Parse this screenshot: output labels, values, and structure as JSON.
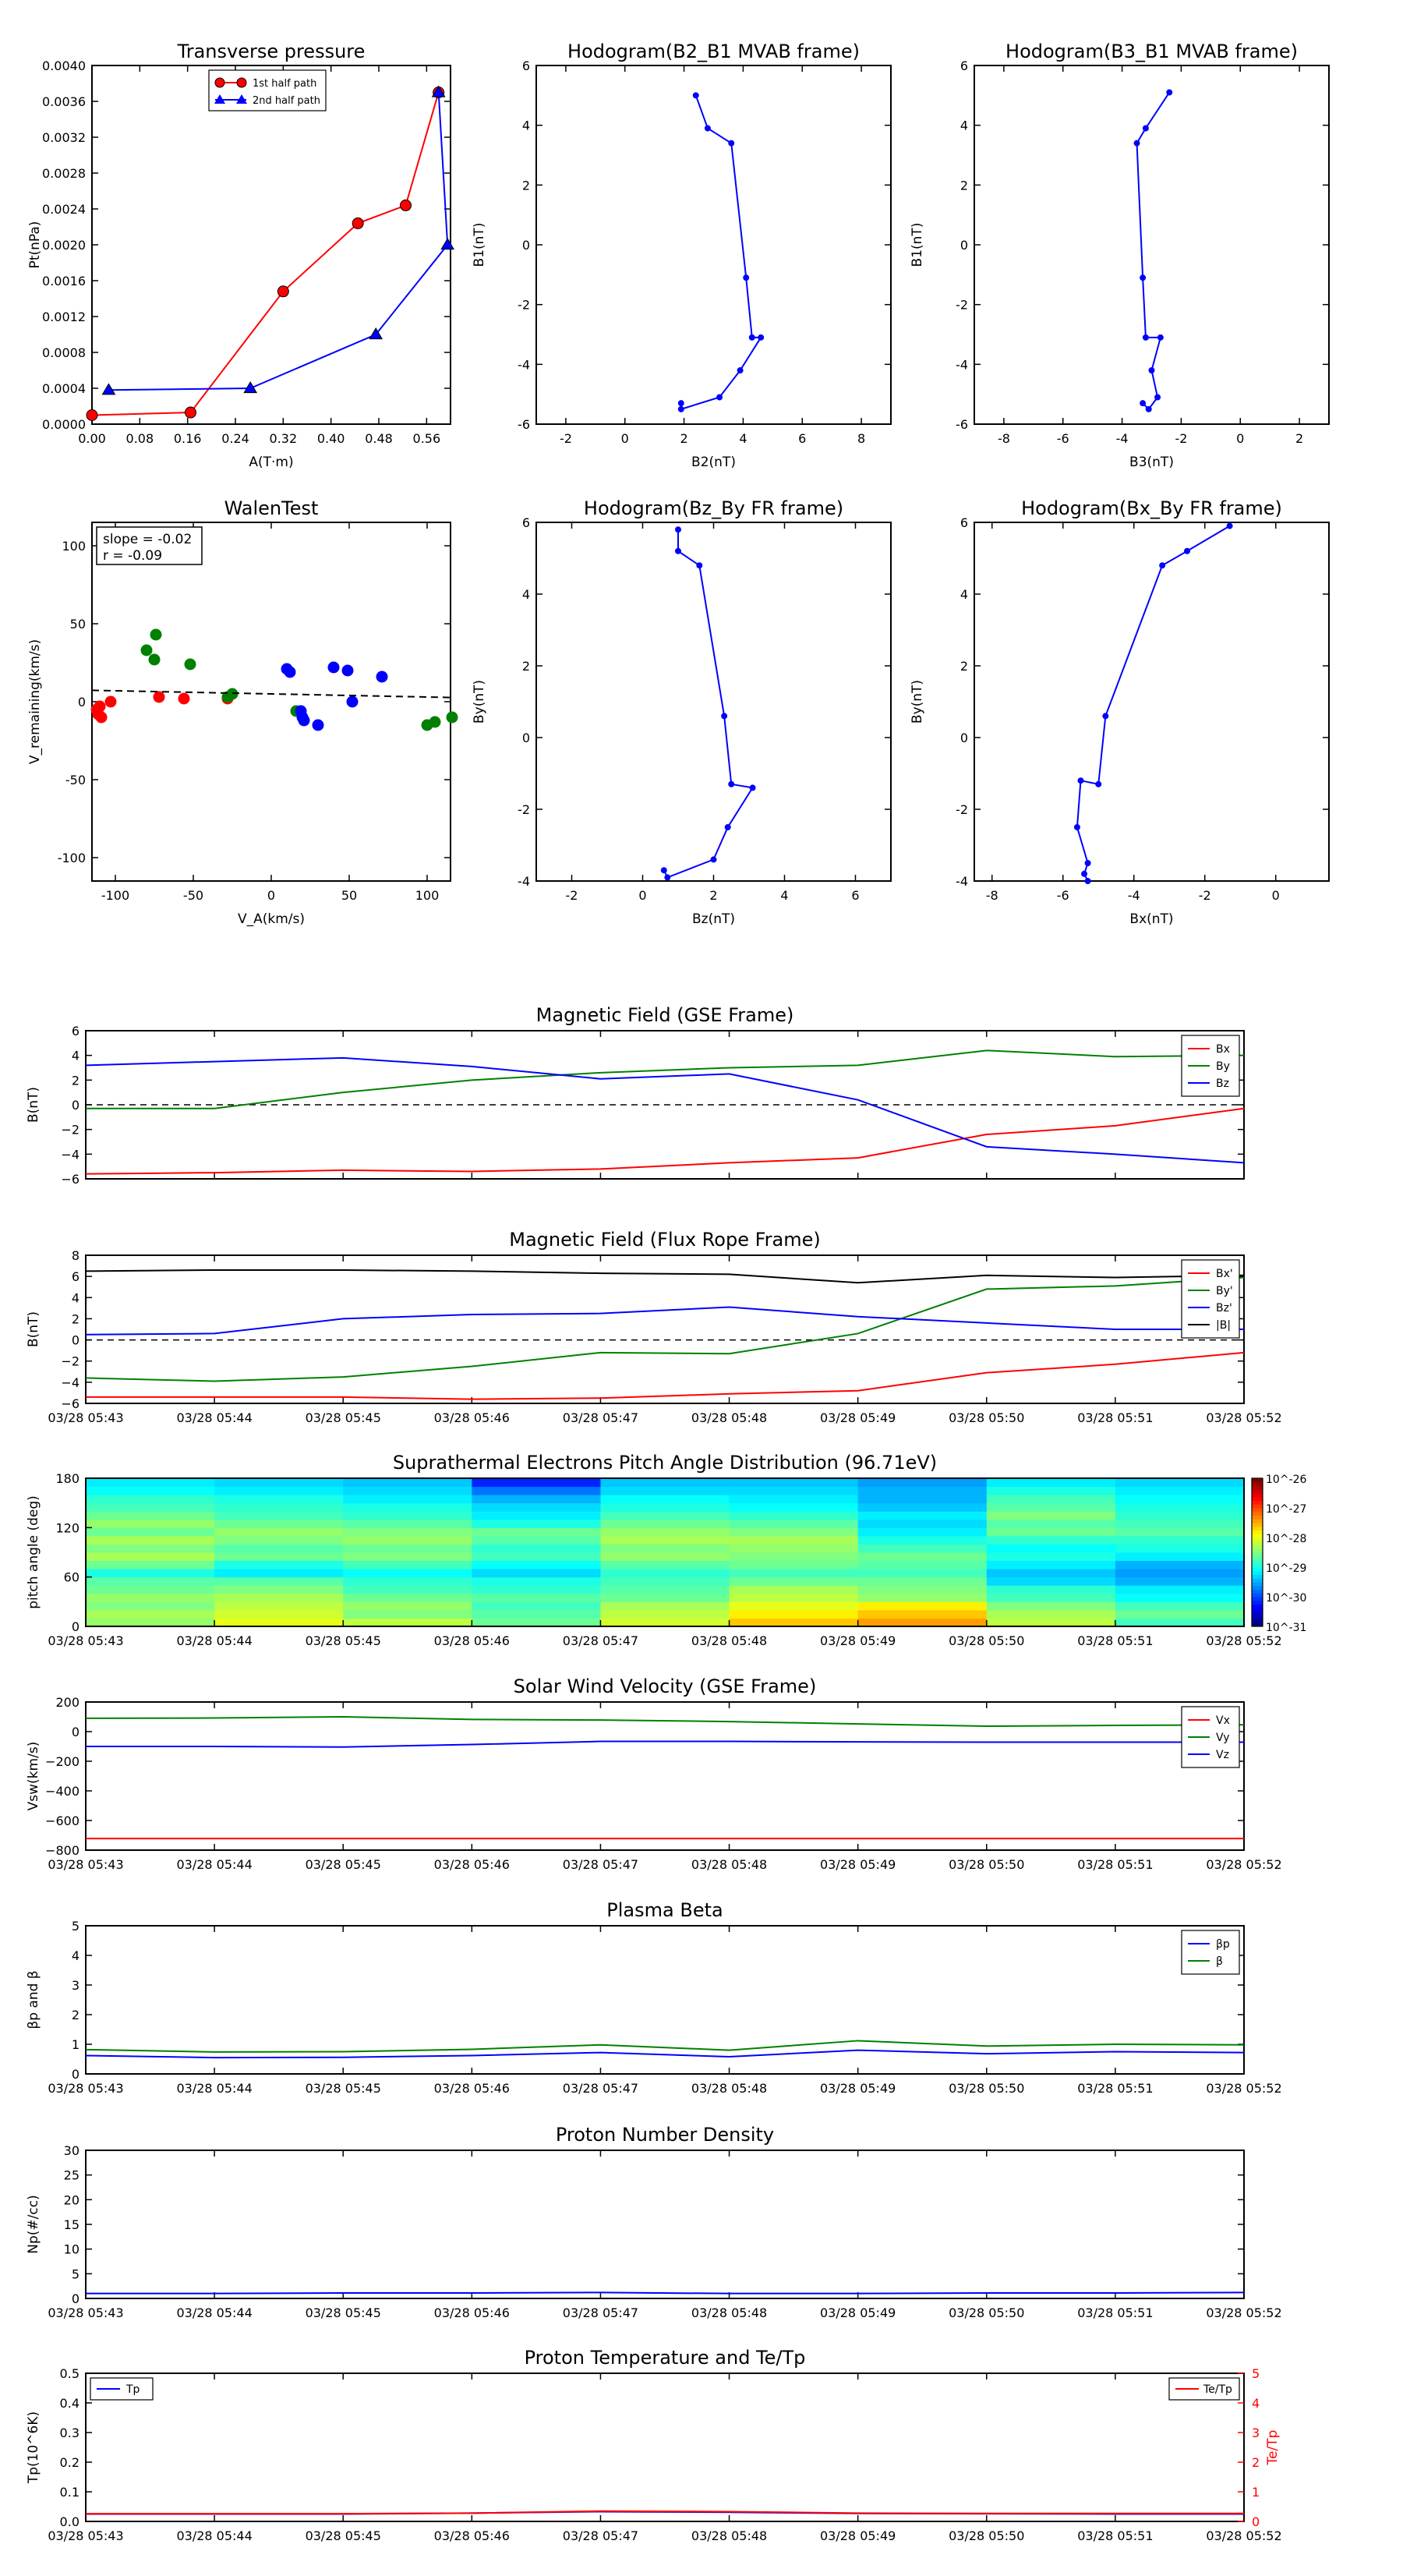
{
  "times": [
    "03/28 05:43",
    "03/28 05:44",
    "03/28 05:45",
    "03/28 05:46",
    "03/28 05:47",
    "03/28 05:48",
    "03/28 05:49",
    "03/28 05:50",
    "03/28 05:51",
    "03/28 05:52"
  ],
  "colors": {
    "red": "#ff0000",
    "green": "#008000",
    "blue": "#0000ff",
    "black": "#000000"
  },
  "chart_data": [
    {
      "id": "pt",
      "type": "line",
      "title": "Transverse pressure",
      "xlabel": "A(T·m)",
      "ylabel": "Pt(nPa)",
      "xlim": [
        0,
        0.6
      ],
      "ylim": [
        0,
        0.004
      ],
      "xticks": [
        "0.00",
        "0.08",
        "0.16",
        "0.24",
        "0.32",
        "0.40",
        "0.48",
        "0.56"
      ],
      "yticks": [
        "0.0000",
        "0.0004",
        "0.0008",
        "0.0012",
        "0.0016",
        "0.0020",
        "0.0024",
        "0.0028",
        "0.0032",
        "0.0036",
        "0.0040"
      ],
      "legend": "top-center",
      "series": [
        {
          "name": "1st half path",
          "color": "red",
          "marker": "circle",
          "x": [
            0.0,
            0.165,
            0.32,
            0.445,
            0.525,
            0.58
          ],
          "y": [
            0.0001,
            0.00013,
            0.00148,
            0.00224,
            0.00244,
            0.0037
          ]
        },
        {
          "name": "2nd half path",
          "color": "blue",
          "marker": "triangle",
          "x": [
            0.58,
            0.595,
            0.475,
            0.265,
            0.028
          ],
          "y": [
            0.0037,
            0.002,
            0.001,
            0.0004,
            0.00038
          ]
        }
      ]
    },
    {
      "id": "h1",
      "type": "line",
      "title": "Hodogram(B2_B1 MVAB frame)",
      "xlabel": "B2(nT)",
      "ylabel": "B1(nT)",
      "xlim": [
        -3,
        9
      ],
      "ylim": [
        -6,
        6
      ],
      "xticks": [
        "-2",
        "0",
        "2",
        "4",
        "6",
        "8"
      ],
      "yticks": [
        "-6",
        "-4",
        "-2",
        "0",
        "2",
        "4",
        "6"
      ],
      "series": [
        {
          "color": "blue",
          "x": [
            2.4,
            2.8,
            3.6,
            4.1,
            4.3,
            4.6,
            3.9,
            3.2,
            1.9,
            1.9
          ],
          "y": [
            5.0,
            3.9,
            3.4,
            -1.1,
            -3.1,
            -3.1,
            -4.2,
            -5.1,
            -5.5,
            -5.3
          ]
        }
      ]
    },
    {
      "id": "h2",
      "type": "line",
      "title": "Hodogram(B3_B1 MVAB frame)",
      "xlabel": "B3(nT)",
      "ylabel": "B1(nT)",
      "xlim": [
        -9,
        3
      ],
      "ylim": [
        -6,
        6
      ],
      "xticks": [
        "-8",
        "-6",
        "-4",
        "-2",
        "0",
        "2"
      ],
      "yticks": [
        "-6",
        "-4",
        "-2",
        "0",
        "2",
        "4",
        "6"
      ],
      "series": [
        {
          "color": "blue",
          "x": [
            -2.4,
            -3.2,
            -3.5,
            -3.3,
            -3.2,
            -2.7,
            -3.0,
            -2.8,
            -3.1,
            -3.3
          ],
          "y": [
            5.1,
            3.9,
            3.4,
            -1.1,
            -3.1,
            -3.1,
            -4.2,
            -5.1,
            -5.5,
            -5.3
          ]
        }
      ]
    },
    {
      "id": "walen",
      "type": "scatter",
      "title": "WalenTest",
      "xlabel": "V_A(km/s)",
      "ylabel": "V_remaining(km/s)",
      "xlim": [
        -115,
        115
      ],
      "ylim": [
        -115,
        115
      ],
      "xticks": [
        "-100",
        "-50",
        "0",
        "50",
        "100"
      ],
      "yticks": [
        "-100",
        "-50",
        "0",
        "50",
        "100"
      ],
      "annotation_lines": [
        "slope = -0.02",
        "r = -0.09"
      ],
      "fit": {
        "slope": -0.02,
        "intercept": 5
      },
      "series": [
        {
          "color": "red",
          "x": [
            -112,
            -111,
            -110,
            -109,
            -103,
            -72,
            -56,
            -28
          ],
          "y": [
            -5,
            -8,
            -3,
            -10,
            0,
            3,
            2,
            2
          ]
        },
        {
          "color": "green",
          "x": [
            -80,
            -75,
            -74,
            -52,
            -28,
            -25,
            16,
            100,
            105,
            116
          ],
          "y": [
            33,
            27,
            43,
            24,
            3,
            5,
            -6,
            -15,
            -13,
            -10
          ]
        },
        {
          "color": "blue",
          "x": [
            10,
            12,
            19,
            20,
            21,
            30,
            40,
            49,
            52,
            71
          ],
          "y": [
            21,
            19,
            -6,
            -10,
            -12,
            -15,
            22,
            20,
            0,
            16
          ]
        }
      ]
    },
    {
      "id": "h3",
      "type": "line",
      "title": "Hodogram(Bz_By FR frame)",
      "xlabel": "Bz(nT)",
      "ylabel": "By(nT)",
      "xlim": [
        -3,
        7
      ],
      "ylim": [
        -4,
        6
      ],
      "xticks": [
        "-2",
        "0",
        "2",
        "4",
        "6"
      ],
      "yticks": [
        "-4",
        "-2",
        "0",
        "2",
        "4",
        "6"
      ],
      "series": [
        {
          "color": "blue",
          "x": [
            1.0,
            1.0,
            1.6,
            2.3,
            2.5,
            3.1,
            2.4,
            2.0,
            0.7,
            0.6
          ],
          "y": [
            5.8,
            5.2,
            4.8,
            0.6,
            -1.3,
            -1.4,
            -2.5,
            -3.4,
            -3.9,
            -3.7
          ]
        }
      ]
    },
    {
      "id": "h4",
      "type": "line",
      "title": "Hodogram(Bx_By FR frame)",
      "xlabel": "Bx(nT)",
      "ylabel": "By(nT)",
      "xlim": [
        -8.5,
        1.5
      ],
      "ylim": [
        -4,
        6
      ],
      "xticks": [
        "-8",
        "-6",
        "-4",
        "-2",
        "0"
      ],
      "yticks": [
        "-4",
        "-2",
        "0",
        "2",
        "4",
        "6"
      ],
      "series": [
        {
          "color": "blue",
          "x": [
            -1.3,
            -2.5,
            -3.2,
            -4.8,
            -5.0,
            -5.5,
            -5.6,
            -5.3,
            -5.4,
            -5.3
          ],
          "y": [
            5.9,
            5.2,
            4.8,
            0.6,
            -1.3,
            -1.2,
            -2.5,
            -3.5,
            -3.8,
            -4.0
          ]
        }
      ]
    },
    {
      "id": "bgse",
      "type": "line",
      "title": "Magnetic Field (GSE Frame)",
      "ylabel": "B(nT)",
      "ylim": [
        -6,
        6
      ],
      "yticks": [
        "−6",
        "−4",
        "−2",
        "0",
        "2",
        "4",
        "6"
      ],
      "xtick_labels": false,
      "zero_line": true,
      "legend": "top-right",
      "series": [
        {
          "name": "Bx",
          "color": "red",
          "values": [
            -5.6,
            -5.5,
            -5.3,
            -5.4,
            -5.2,
            -4.7,
            -4.3,
            -2.4,
            -1.7,
            -0.3
          ]
        },
        {
          "name": "By",
          "color": "green",
          "values": [
            -0.3,
            -0.3,
            1.0,
            2.0,
            2.6,
            3.0,
            3.2,
            4.4,
            3.9,
            4.0
          ]
        },
        {
          "name": "Bz",
          "color": "blue",
          "values": [
            3.2,
            3.5,
            3.8,
            3.1,
            2.1,
            2.5,
            0.4,
            -3.4,
            -4.0,
            -4.7
          ]
        }
      ]
    },
    {
      "id": "bfr",
      "type": "line",
      "title": "Magnetic Field (Flux Rope Frame)",
      "ylabel": "B(nT)",
      "ylim": [
        -6,
        8
      ],
      "yticks": [
        "−6",
        "−4",
        "−2",
        "0",
        "2",
        "4",
        "6",
        "8"
      ],
      "xtick_labels": true,
      "zero_line": true,
      "legend": "top-right",
      "series": [
        {
          "name": "Bx'",
          "color": "red",
          "values": [
            -5.4,
            -5.4,
            -5.4,
            -5.6,
            -5.5,
            -5.1,
            -4.8,
            -3.1,
            -2.3,
            -1.2
          ]
        },
        {
          "name": "By'",
          "color": "green",
          "values": [
            -3.6,
            -3.9,
            -3.5,
            -2.5,
            -1.2,
            -1.3,
            0.6,
            4.8,
            5.1,
            5.9
          ]
        },
        {
          "name": "Bz'",
          "color": "blue",
          "values": [
            0.5,
            0.6,
            2.0,
            2.4,
            2.5,
            3.1,
            2.2,
            1.6,
            1.0,
            1.0
          ]
        },
        {
          "name": "|B|",
          "color": "black",
          "values": [
            6.5,
            6.6,
            6.6,
            6.5,
            6.3,
            6.2,
            5.4,
            6.1,
            5.9,
            6.1
          ]
        }
      ]
    },
    {
      "id": "pad",
      "type": "heatmap",
      "title": "Suprathermal Electrons Pitch Angle Distribution (96.71eV)",
      "ylabel": "pitch angle (deg)",
      "ylim": [
        0,
        180
      ],
      "yticks": [
        "0",
        "60",
        "120",
        "180"
      ],
      "xtick_labels": true,
      "colorbar": {
        "labels": [
          "10^-31",
          "10^-30",
          "10^-29",
          "10^-28",
          "10^-27",
          "10^-26"
        ],
        "range_exp": [
          -31,
          -26
        ]
      },
      "bins": [
        [
          -28.4,
          -28.0,
          -28.2,
          -28.6,
          -28.1,
          -27.6,
          -27.4,
          -28.2,
          -28.8
        ],
        [
          -28.3,
          -28.1,
          -28.5,
          -28.7,
          -28.2,
          -27.8,
          -27.6,
          -28.3,
          -28.6
        ],
        [
          -28.5,
          -28.2,
          -28.4,
          -28.8,
          -28.3,
          -28.0,
          -27.8,
          -28.5,
          -28.8
        ],
        [
          -28.4,
          -28.3,
          -28.6,
          -28.7,
          -28.6,
          -28.2,
          -28.4,
          -28.8,
          -29.1
        ],
        [
          -28.6,
          -28.5,
          -28.8,
          -28.9,
          -28.7,
          -28.3,
          -28.5,
          -28.9,
          -29.2
        ],
        [
          -28.7,
          -28.7,
          -28.9,
          -29.0,
          -28.8,
          -28.6,
          -28.6,
          -29.3,
          -29.5
        ],
        [
          -29.0,
          -29.2,
          -29.1,
          -29.3,
          -28.9,
          -28.8,
          -28.8,
          -29.4,
          -29.6
        ],
        [
          -28.6,
          -29.0,
          -28.8,
          -29.1,
          -28.7,
          -28.6,
          -28.7,
          -29.2,
          -29.5
        ],
        [
          -28.3,
          -28.6,
          -28.5,
          -28.8,
          -28.4,
          -28.5,
          -28.6,
          -29.0,
          -29.2
        ],
        [
          -28.5,
          -28.7,
          -28.6,
          -28.9,
          -28.5,
          -28.4,
          -28.8,
          -29.1,
          -29.0
        ],
        [
          -28.3,
          -28.5,
          -28.4,
          -28.7,
          -28.3,
          -28.3,
          -29.0,
          -28.9,
          -28.9
        ],
        [
          -28.6,
          -28.4,
          -28.5,
          -28.6,
          -28.4,
          -28.5,
          -29.2,
          -28.6,
          -28.7
        ],
        [
          -28.4,
          -28.6,
          -28.7,
          -29.0,
          -28.6,
          -28.7,
          -29.3,
          -28.7,
          -28.8
        ],
        [
          -28.6,
          -28.8,
          -28.9,
          -29.2,
          -28.8,
          -28.9,
          -29.2,
          -28.5,
          -28.9
        ],
        [
          -28.8,
          -28.9,
          -29.0,
          -29.3,
          -29.0,
          -29.1,
          -29.4,
          -28.7,
          -29.0
        ],
        [
          -28.9,
          -29.0,
          -29.2,
          -29.5,
          -29.1,
          -29.2,
          -29.5,
          -28.8,
          -29.1
        ],
        [
          -29.1,
          -29.2,
          -29.3,
          -29.8,
          -29.3,
          -29.3,
          -29.5,
          -29.0,
          -29.2
        ],
        [
          -29.2,
          -29.3,
          -29.4,
          -30.2,
          -29.4,
          -29.4,
          -29.6,
          -29.2,
          -29.3
        ]
      ]
    },
    {
      "id": "vsw",
      "type": "line",
      "title": "Solar Wind Velocity (GSE Frame)",
      "ylabel": "Vsw(km/s)",
      "ylim": [
        -800,
        200
      ],
      "yticks": [
        "−800",
        "−600",
        "−400",
        "−200",
        "0",
        "200"
      ],
      "xtick_labels": true,
      "legend": "top-right",
      "series": [
        {
          "name": "Vx",
          "color": "red",
          "values": [
            -722,
            -722,
            -722,
            -722,
            -722,
            -722,
            -722,
            -722,
            -722,
            -722
          ]
        },
        {
          "name": "Vy",
          "color": "green",
          "values": [
            90,
            92,
            100,
            82,
            78,
            68,
            52,
            37,
            42,
            46
          ]
        },
        {
          "name": "Vz",
          "color": "blue",
          "values": [
            -100,
            -100,
            -104,
            -87,
            -66,
            -66,
            -69,
            -71,
            -71,
            -71
          ]
        }
      ]
    },
    {
      "id": "beta",
      "type": "line",
      "title": "Plasma Beta",
      "ylabel": "βp and β",
      "ylim": [
        0,
        5
      ],
      "yticks": [
        "0",
        "1",
        "2",
        "3",
        "4",
        "5"
      ],
      "xtick_labels": true,
      "legend": "top-right",
      "series": [
        {
          "name": "βp",
          "color": "blue",
          "values": [
            0.62,
            0.55,
            0.56,
            0.62,
            0.72,
            0.58,
            0.8,
            0.68,
            0.75,
            0.72
          ]
        },
        {
          "name": "β",
          "color": "green",
          "values": [
            0.82,
            0.74,
            0.75,
            0.83,
            0.98,
            0.8,
            1.12,
            0.94,
            1.0,
            0.98
          ]
        }
      ]
    },
    {
      "id": "np",
      "type": "line",
      "title": "Proton Number Density",
      "ylabel": "Np(#/cc)",
      "ylim": [
        0,
        30
      ],
      "yticks": [
        "0",
        "5",
        "10",
        "15",
        "20",
        "25",
        "30"
      ],
      "xtick_labels": true,
      "series": [
        {
          "name": "Np",
          "color": "blue",
          "values": [
            1.0,
            1.0,
            1.1,
            1.1,
            1.2,
            1.0,
            1.0,
            1.1,
            1.1,
            1.2
          ]
        }
      ]
    },
    {
      "id": "tp",
      "type": "line",
      "title": "Proton Temperature and Te/Tp",
      "ylabel": "Tp(10^6K)",
      "ylabel_right": "Te/Tp",
      "ylim": [
        0,
        0.5
      ],
      "ylim_right": [
        0,
        5
      ],
      "yticks": [
        "0.0",
        "0.1",
        "0.2",
        "0.3",
        "0.4",
        "0.5"
      ],
      "yticks_right": [
        "0",
        "1",
        "2",
        "3",
        "4",
        "5"
      ],
      "xtick_labels": true,
      "legend_left": "Tp",
      "legend_right": "Te/Tp",
      "series": [
        {
          "name": "Tp",
          "color": "blue",
          "values": [
            0.025,
            0.025,
            0.025,
            0.028,
            0.033,
            0.031,
            0.027,
            0.026,
            0.025,
            0.025
          ]
        },
        {
          "name": "Te/Tp",
          "color": "red",
          "axis": "right",
          "values": [
            0.26,
            0.26,
            0.26,
            0.28,
            0.35,
            0.33,
            0.28,
            0.27,
            0.27,
            0.27
          ]
        }
      ]
    }
  ]
}
